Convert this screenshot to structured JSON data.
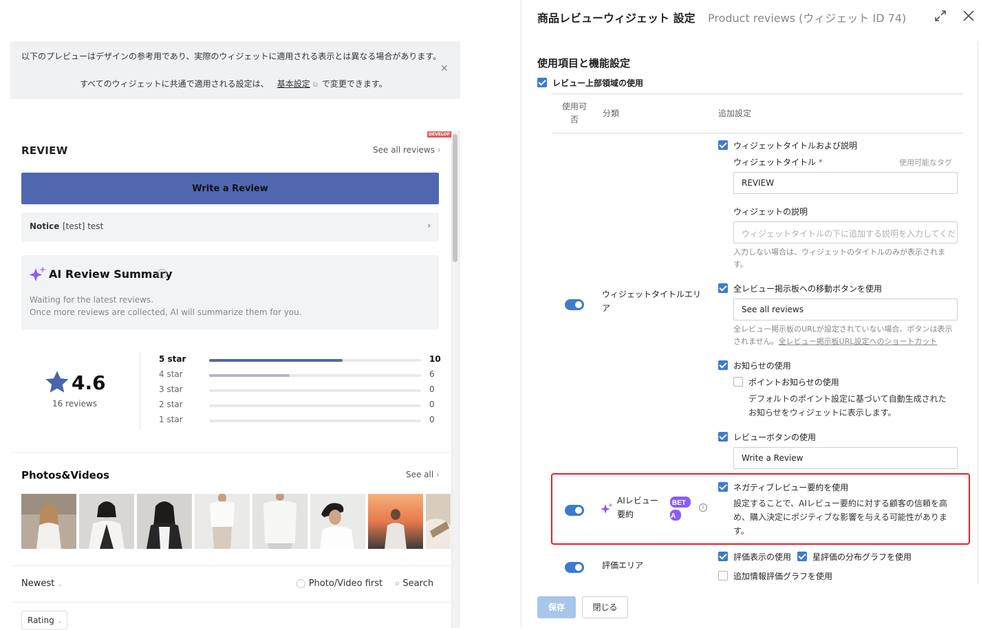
{
  "preview_notice": {
    "line1": "以下のプレビューはデザインの参考用であり、実際のウィジェットに適用される表示とは異なる場合があります。",
    "line2_prefix": "すべてのウィジェットに共通で適用される設定は、",
    "line2_link": "基本設定",
    "line2_suffix": "で変更できます。"
  },
  "preview": {
    "develop_badge": "DEVELOP",
    "review_title": "REVIEW",
    "see_all_reviews": "See all reviews",
    "write_review_button": "Write a Review",
    "notice_label": "Notice",
    "notice_text": "[test] test",
    "ai_summary": {
      "title": "AI Review Summary",
      "line1": "Waiting for the latest reviews.",
      "line2": "Once more reviews are collected, AI will summarize them for you."
    },
    "rating": {
      "average": "4.6",
      "count_label": "16 reviews",
      "distribution": [
        {
          "label": "5 star",
          "count": 10,
          "fraction": 0.63,
          "strong": true
        },
        {
          "label": "4 star",
          "count": 6,
          "fraction": 0.38,
          "strong": false
        },
        {
          "label": "3 star",
          "count": 0,
          "fraction": 0,
          "strong": false
        },
        {
          "label": "2 star",
          "count": 0,
          "fraction": 0,
          "strong": false
        },
        {
          "label": "1 star",
          "count": 0,
          "fraction": 0,
          "strong": false
        }
      ],
      "bar_color_primary": "#5067b0",
      "bar_color_secondary": "#b4b7bf"
    },
    "photos_title": "Photos&Videos",
    "photos_see_all": "See all",
    "sort_label": "Newest",
    "photo_first_label": "Photo/Video first",
    "search_label": "Search",
    "rating_filter_label": "Rating"
  },
  "panel": {
    "title": "商品レビューウィジェット 設定",
    "subtitle": "Product reviews (ウィジェット ID 74)",
    "section_title": "使用項目と機能設定",
    "top_area_label": "レビュー上部領域の使用",
    "headers": {
      "enable": "使用可否",
      "category": "分類",
      "extra": "追加設定"
    },
    "title_area": {
      "category": "ウィジェットタイトルエリア",
      "widget_title_desc_label": "ウィジェットタイトルおよび説明",
      "widget_title_label": "ウィジェットタイトル",
      "required_mark": "*",
      "available_tags": "使用可能なタグ",
      "widget_title_value": "REVIEW",
      "widget_desc_label": "ウィジェットの説明",
      "widget_desc_placeholder": "ウィジェットタイトルの下に追加する説明を入力してください",
      "widget_desc_hint": "入力しない場合は、ウィジェットのタイトルのみが表示されます。",
      "all_reviews_btn_label": "全レビュー掲示板への移動ボタンを使用",
      "all_reviews_btn_value": "See all reviews",
      "all_reviews_hint": "全レビュー掲示板のURLが設定されていない場合、ボタンは表示されません。",
      "all_reviews_hint_link": "全レビュー掲示板URL設定へのショートカット",
      "notice_use_label": "お知らせの使用",
      "point_notice_label": "ポイントお知らせの使用",
      "point_notice_desc": "デフォルトのポイント設定に基づいて自動生成されたお知らせをウィジェットに表示します。",
      "review_btn_label": "レビューボタンの使用",
      "review_btn_value": "Write a Review"
    },
    "ai_summary_row": {
      "category": "AIレビュー要約",
      "beta": "BETA",
      "negative_label": "ネガティブレビュー要約を使用",
      "negative_desc": "設定することで、AIレビュー要約に対する顧客の信頼を高め、購入決定にポジティブな影響を与える可能性があります。"
    },
    "rating_row": {
      "category": "評価エリア",
      "display_label": "評価表示の使用",
      "distribution_label": "星評価の分布グラフを使用",
      "extra_graph_label": "追加情報評価グラフを使用"
    },
    "save_button": "保存",
    "close_button": "閉じる"
  },
  "colors": {
    "accent": "#3d7bd1",
    "highlight": "#e0202c",
    "brand_button": "#5067b0",
    "ai_purple": "#8b5cf6"
  }
}
